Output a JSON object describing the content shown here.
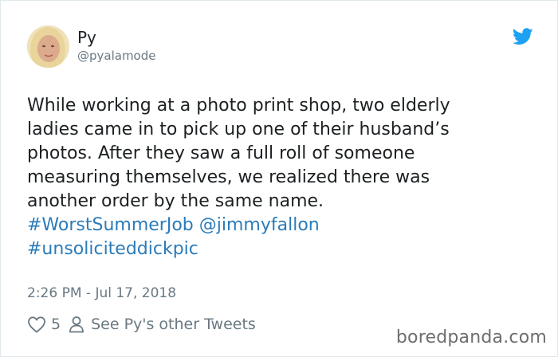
{
  "author": {
    "name": "Py",
    "handle": "@pyalamode"
  },
  "tweet": {
    "lines": [
      "While working at a photo print shop, two elderly",
      "ladies came in to pick up one of their husband’s",
      "photos. After they saw a full roll of someone",
      "measuring themselves, we realized there was",
      "another order by the same name."
    ],
    "hashtag1": "#WorstSummerJob",
    "mention": "@jimmyfallon",
    "hashtag2": "#unsoliciteddickpic"
  },
  "timestamp": "2:26 PM - Jul 17, 2018",
  "actions": {
    "like_count": "5",
    "see_other": "See Py's other Tweets"
  },
  "watermark": "boredpanda.com",
  "colors": {
    "link": "#2b7bb9",
    "twitter_blue": "#1da1f2",
    "muted": "#697882"
  },
  "icons": [
    "twitter-bird-icon",
    "heart-icon",
    "person-icon"
  ]
}
